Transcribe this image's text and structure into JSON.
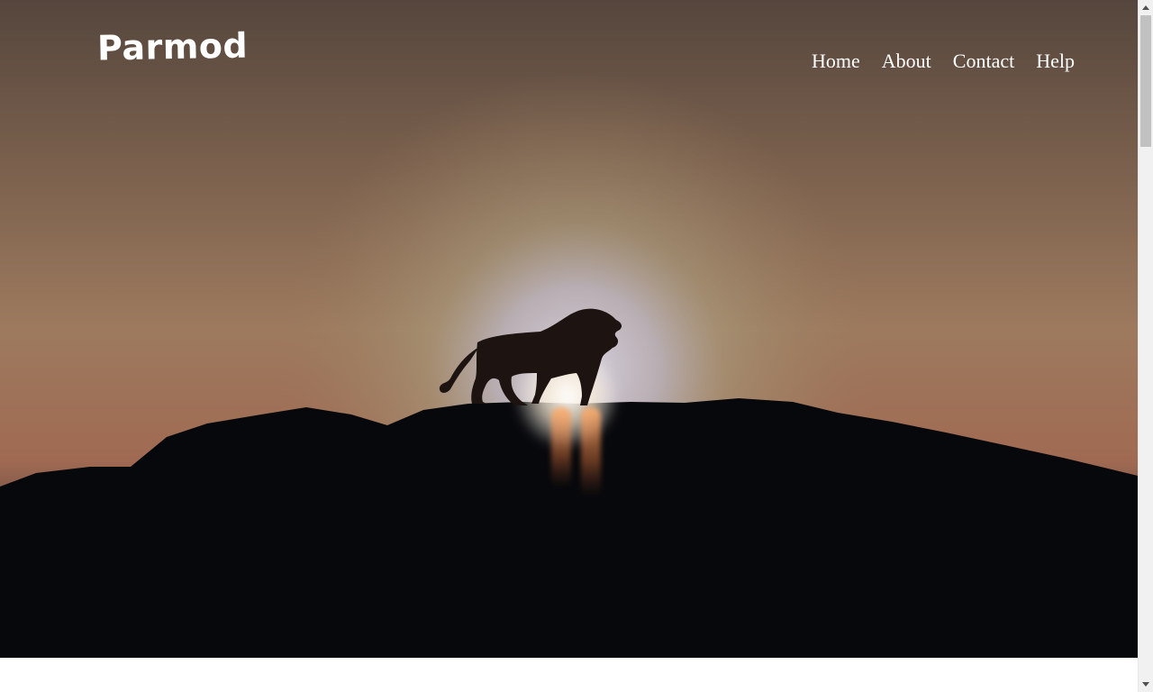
{
  "header": {
    "logo_text": "Parmod",
    "nav": [
      {
        "label": "Home"
      },
      {
        "label": "About"
      },
      {
        "label": "Contact"
      },
      {
        "label": "Help"
      }
    ]
  },
  "hero": {
    "image_description_icon": "lion-silhouette-sunset-image"
  },
  "colors": {
    "nav_text": "#ffffff",
    "sky_top": "#5a4a40",
    "sky_glow": "#c9c4cf",
    "ground": "#07080c",
    "scrollbar_track": "#f1f1f1",
    "scrollbar_thumb": "#c1c1c1"
  }
}
